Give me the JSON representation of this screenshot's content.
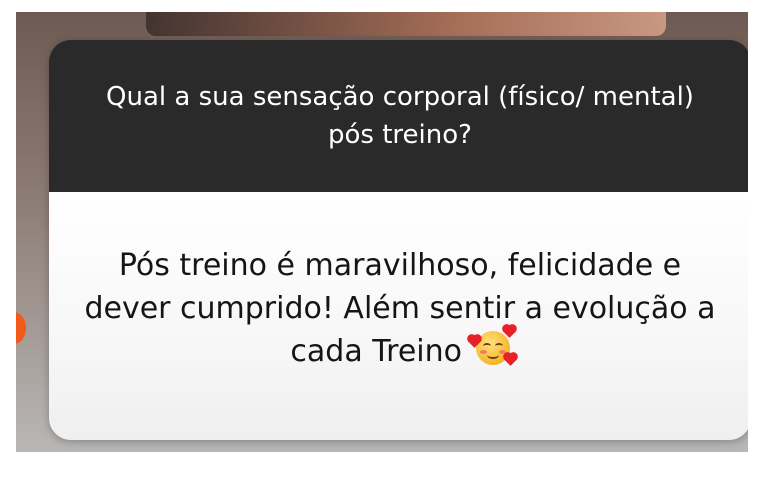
{
  "question_box": {
    "question": "Qual a sua sensação corporal (físico/ mental) pós treino?"
  },
  "answer_box": {
    "answer": "Pós treino é maravilhoso, felicidade e dever cumprido! Além sentir a evolução a cada Treino",
    "emoji": "smiling-face-with-hearts-icon"
  },
  "colors": {
    "question_background": "#2a2a2a",
    "question_text": "#ffffff",
    "answer_background": "#f7f7f7",
    "answer_text": "#151515",
    "background_accent": "#f05a1a"
  }
}
